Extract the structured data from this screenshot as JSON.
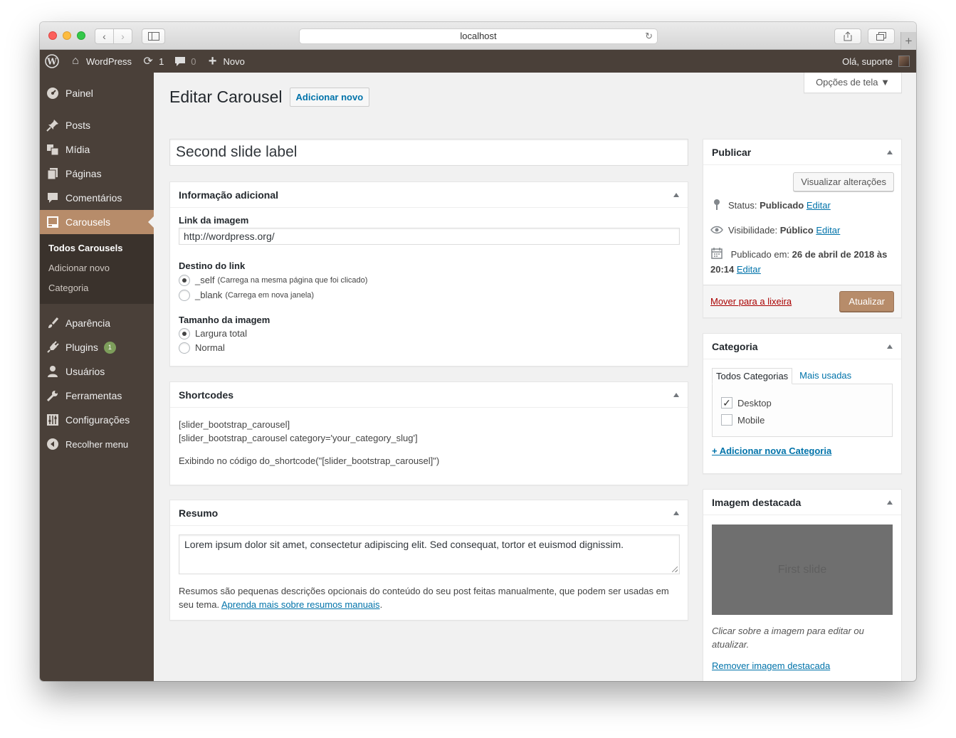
{
  "browser": {
    "url": "localhost",
    "back_icon": "‹",
    "forward_icon": "›",
    "reload_icon": "↻",
    "new_tab_icon": "+"
  },
  "adminbar": {
    "site_name": "WordPress",
    "updates_count": "1",
    "comments_count": "0",
    "new_label": "Novo",
    "greeting": "Olá, suporte"
  },
  "menu": {
    "items": [
      {
        "label": "Painel",
        "icon": "dashboard-icon"
      },
      {
        "label": "Posts",
        "icon": "pin-icon"
      },
      {
        "label": "Mídia",
        "icon": "media-icon"
      },
      {
        "label": "Páginas",
        "icon": "page-icon"
      },
      {
        "label": "Comentários",
        "icon": "comment-icon"
      },
      {
        "label": "Carousels",
        "icon": "gallery-icon"
      },
      {
        "label": "Aparência",
        "icon": "brush-icon"
      },
      {
        "label": "Plugins",
        "icon": "plug-icon"
      },
      {
        "label": "Usuários",
        "icon": "user-icon"
      },
      {
        "label": "Ferramentas",
        "icon": "wrench-icon"
      },
      {
        "label": "Configurações",
        "icon": "settings-icon"
      },
      {
        "label": "Recolher menu",
        "icon": "collapse-icon"
      }
    ],
    "submenu": [
      "Todos Carousels",
      "Adicionar novo",
      "Categoria"
    ],
    "plugins_badge": "1"
  },
  "page": {
    "screen_options": "Opções de tela ▼",
    "title": "Editar Carousel",
    "add_new": "Adicionar novo",
    "post_title": "Second slide label"
  },
  "info_box": {
    "title": "Informação adicional",
    "link_label": "Link da imagem",
    "link_value": "http://wordpress.org/",
    "target_label": "Destino do link",
    "self_label": "_self",
    "self_hint": "(Carrega na mesma página que foi clicado)",
    "blank_label": "_blank",
    "blank_hint": "(Carrega em nova janela)",
    "size_label": "Tamanho da imagem",
    "size_full": "Largura total",
    "size_normal": "Normal"
  },
  "shortcodes_box": {
    "title": "Shortcodes",
    "line1": "[slider_bootstrap_carousel]",
    "line2": "[slider_bootstrap_carousel category='your_category_slug']",
    "line3": "Exibindo no código do_shortcode(\"[slider_bootstrap_carousel]\")"
  },
  "excerpt_box": {
    "title": "Resumo",
    "value": "Lorem ipsum dolor sit amet, consectetur adipiscing elit. Sed consequat, tortor et euismod dignissim.",
    "help": "Resumos são pequenas descrições opcionais do conteúdo do seu post feitas manualmente, que podem ser usadas em seu tema.",
    "help_link": "Aprenda mais sobre resumos manuais",
    "help_end": "."
  },
  "publish_box": {
    "title": "Publicar",
    "preview": "Visualizar alterações",
    "status_label": "Status:",
    "status_value": "Publicado",
    "visibility_label": "Visibilidade:",
    "visibility_value": "Público",
    "published_label": "Publicado em:",
    "published_value": "26 de abril de 2018 às 20:14",
    "edit": "Editar",
    "trash": "Mover para a lixeira",
    "update": "Atualizar"
  },
  "category_box": {
    "title": "Categoria",
    "tab_all": "Todos Categorias",
    "tab_popular": "Mais usadas",
    "options": [
      {
        "label": "Desktop",
        "checked": true
      },
      {
        "label": "Mobile",
        "checked": false
      }
    ],
    "add_new": "+ Adicionar nova Categoria"
  },
  "featured_box": {
    "title": "Imagem destacada",
    "thumb_text": "First slide",
    "hint": "Clicar sobre a imagem para editar ou atualizar.",
    "remove": "Remover imagem destacada"
  },
  "colors": {
    "admin_bg": "#4a4039",
    "accent": "#b78c6a",
    "link": "#0073aa"
  }
}
